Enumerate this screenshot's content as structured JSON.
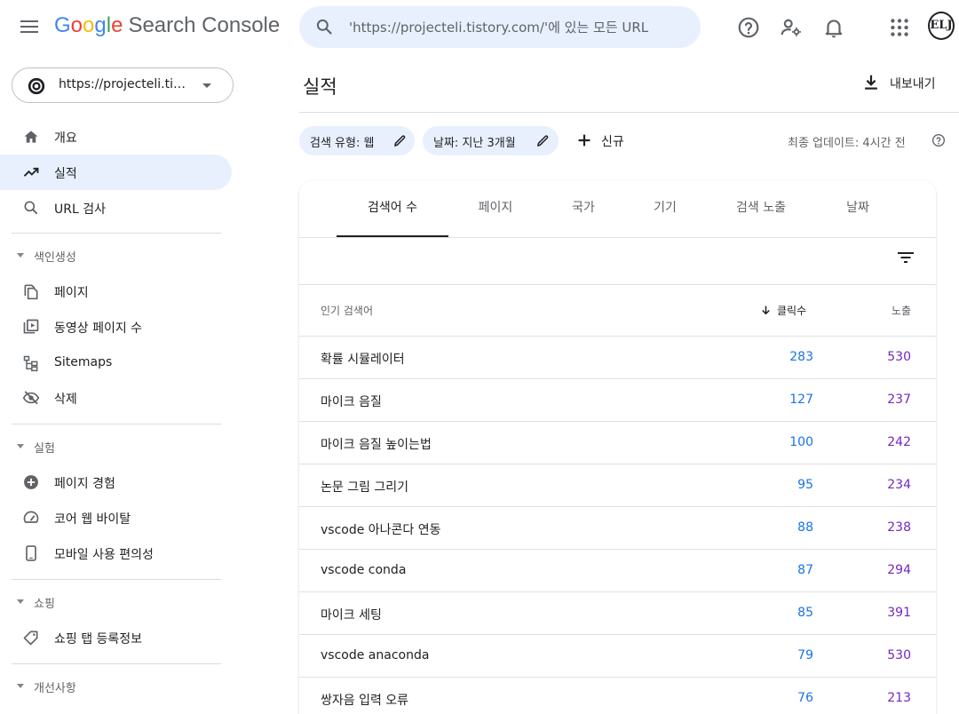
{
  "header": {
    "logo": [
      "G",
      "o",
      "o",
      "g",
      "l",
      "e"
    ],
    "product": "Search Console",
    "search_placeholder": "'https://projecteli.tistory.com/'에 있는 모든 URL",
    "avatar_text": "ELJ"
  },
  "sidebar": {
    "property": "https://projecteli.tistory.com/",
    "items": [
      {
        "label": "개요",
        "icon": "home-icon"
      },
      {
        "label": "실적",
        "icon": "trending-up-icon",
        "active": true
      },
      {
        "label": "URL 검사",
        "icon": "search-icon"
      }
    ],
    "sections": [
      {
        "title": "색인생성",
        "items": [
          {
            "label": "페이지",
            "icon": "pages-icon"
          },
          {
            "label": "동영상 페이지 수",
            "icon": "video-pages-icon"
          },
          {
            "label": "Sitemaps",
            "icon": "sitemap-icon"
          },
          {
            "label": "삭제",
            "icon": "visibility-off-icon"
          }
        ]
      },
      {
        "title": "실험",
        "items": [
          {
            "label": "페이지 경험",
            "icon": "plus-circle-icon"
          },
          {
            "label": "코어 웹 바이탈",
            "icon": "speed-icon"
          },
          {
            "label": "모바일 사용 편의성",
            "icon": "phone-icon"
          }
        ]
      },
      {
        "title": "쇼핑",
        "items": [
          {
            "label": "쇼핑 탭 등록정보",
            "icon": "tag-icon"
          }
        ]
      },
      {
        "title": "개선사항",
        "items": []
      }
    ]
  },
  "main": {
    "title": "실적",
    "export_label": "내보내기",
    "chips": [
      "검색 유형: 웹",
      "날짜: 지난 3개월"
    ],
    "new_label": "신규",
    "last_updated": "최종 업데이트: 4시간 전",
    "tabs": [
      "검색어 수",
      "페이지",
      "국가",
      "기기",
      "검색 노출",
      "날짜"
    ],
    "active_tab": 0,
    "table": {
      "columns": [
        "인기 검색어",
        "클릭수",
        "노출"
      ],
      "rows": [
        {
          "query": "확률 시뮬레이터",
          "clicks": "283",
          "impressions": "530"
        },
        {
          "query": "마이크 음질",
          "clicks": "127",
          "impressions": "237"
        },
        {
          "query": "마이크 음질 높이는법",
          "clicks": "100",
          "impressions": "242"
        },
        {
          "query": "논문 그림 그리기",
          "clicks": "95",
          "impressions": "234"
        },
        {
          "query": "vscode 아나콘다 연동",
          "clicks": "88",
          "impressions": "238"
        },
        {
          "query": "vscode conda",
          "clicks": "87",
          "impressions": "294"
        },
        {
          "query": "마이크 세팅",
          "clicks": "85",
          "impressions": "391"
        },
        {
          "query": "vscode anaconda",
          "clicks": "79",
          "impressions": "530"
        },
        {
          "query": "쌍자음 입력 오류",
          "clicks": "76",
          "impressions": "213"
        }
      ]
    }
  },
  "colors": {
    "accent_bg": "#e8f0fe",
    "clicks": "#1a73e8",
    "impressions": "#7627bb"
  }
}
